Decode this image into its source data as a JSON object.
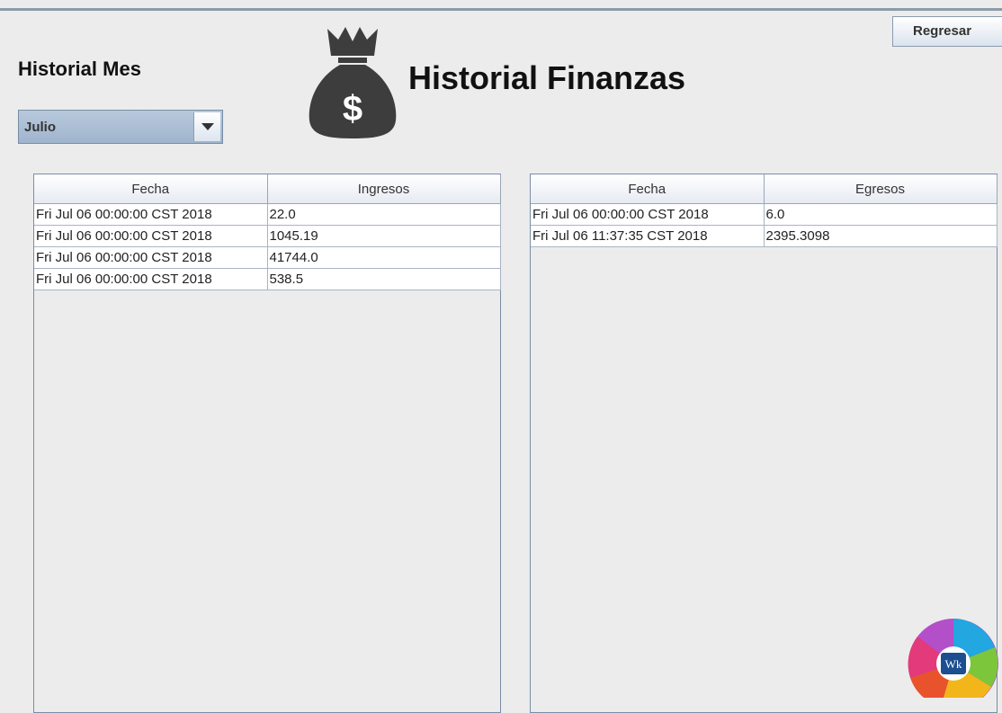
{
  "header": {
    "back_label": "Regresar",
    "section_title": "Historial Mes",
    "main_title": "Historial Finanzas",
    "money_icon": "money-bag-icon",
    "dollar_symbol": "$"
  },
  "month_select": {
    "value": "Julio"
  },
  "ingresos_table": {
    "columns": [
      "Fecha",
      "Ingresos"
    ],
    "rows": [
      [
        "Fri Jul 06 00:00:00 CST 2018",
        "22.0"
      ],
      [
        "Fri Jul 06 00:00:00 CST 2018",
        "1045.19"
      ],
      [
        "Fri Jul 06 00:00:00 CST 2018",
        "41744.0"
      ],
      [
        "Fri Jul 06 00:00:00 CST 2018",
        "538.5"
      ]
    ]
  },
  "egresos_table": {
    "columns": [
      "Fecha",
      "Egresos"
    ],
    "rows": [
      [
        "Fri Jul 06 00:00:00 CST 2018",
        "6.0"
      ],
      [
        "Fri Jul 06 11:37:35 CST 2018",
        "2395.3098"
      ]
    ]
  },
  "logo": {
    "text": "Wk",
    "name": "app-logo"
  },
  "colors": {
    "accent_blue": "#1d4e8f",
    "icon_gray": "#3d3d3d",
    "combo_blue": "#a9bcd3"
  }
}
